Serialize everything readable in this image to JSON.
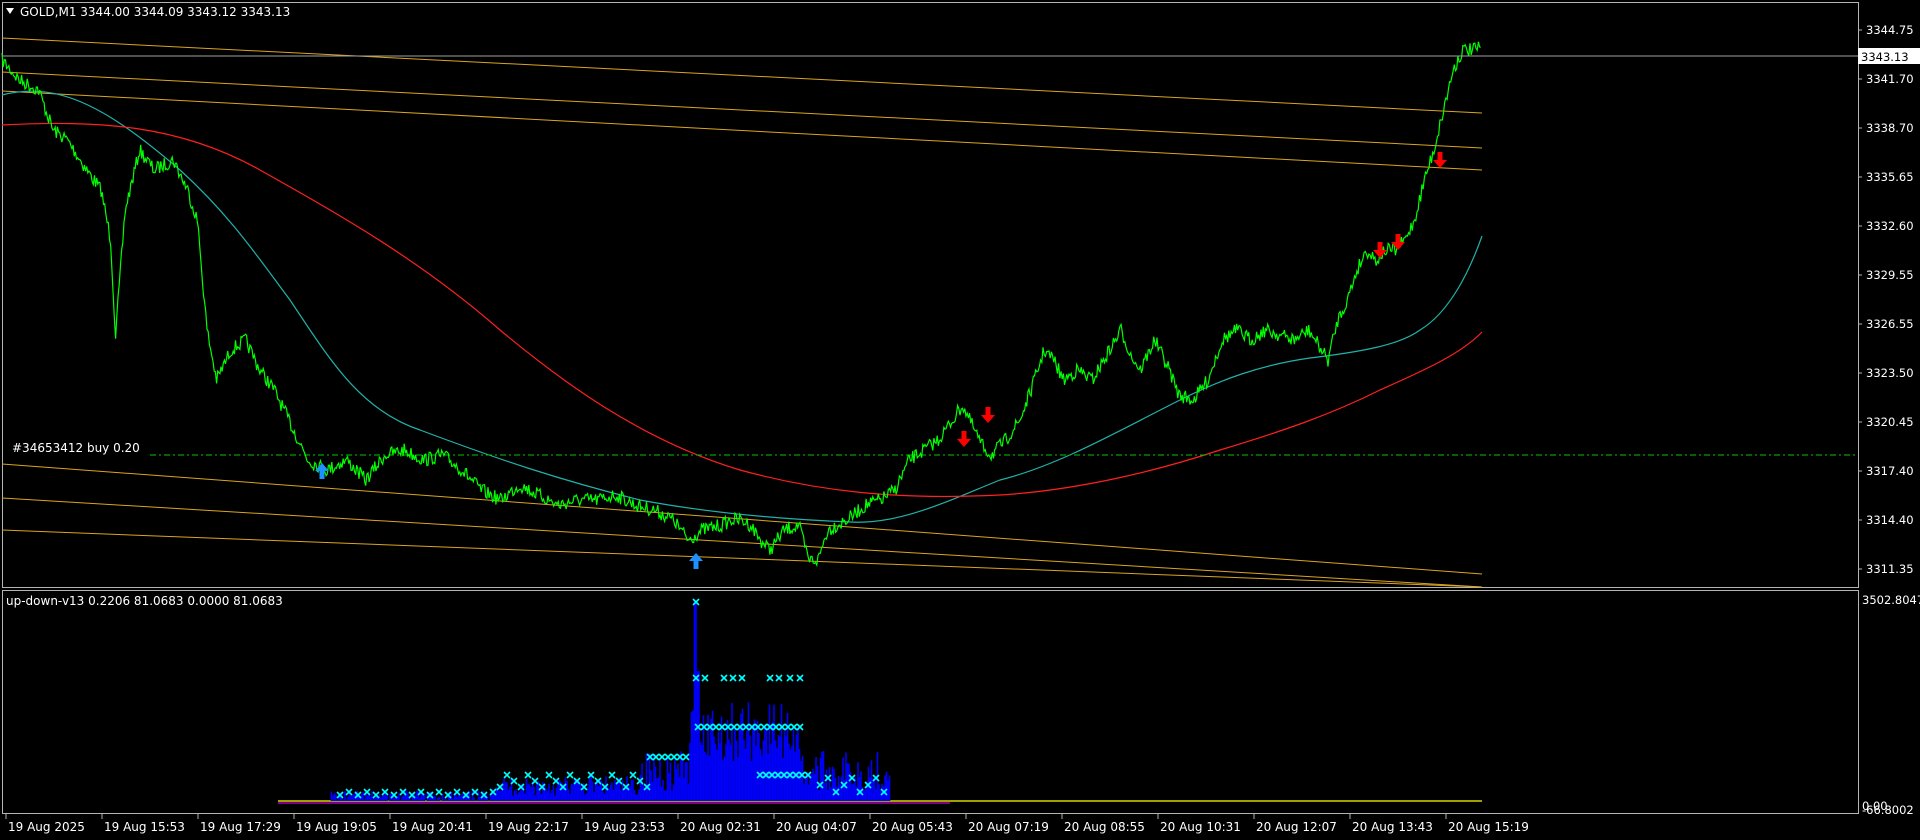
{
  "chart": {
    "header_text": "GOLD,M1  3344.00 3344.09 3343.12 3343.13",
    "current_price": "3343.13",
    "price_labels": [
      "3344.75",
      "3341.70",
      "3338.70",
      "3335.65",
      "3332.60",
      "3329.55",
      "3326.55",
      "3323.50",
      "3320.45",
      "3317.40",
      "3314.40",
      "3311.35"
    ],
    "order_label": "#34653412 buy 0.20",
    "colors": {
      "price_line": "#00ff00",
      "ma_fast": "#20b2aa",
      "ma_slow": "#ff2020",
      "channel": "#daa520",
      "order_line": "#00c800",
      "up_arrow": "#1e90ff",
      "down_arrow": "#ff0000"
    }
  },
  "indicator": {
    "header_text": "up-down-v13 0.2206 81.0683 0.0000 81.0683",
    "top_label": "3502.8047",
    "bottom_label_a": "0.00",
    "bottom_label_b": "-66.8002",
    "colors": {
      "histogram": "#0000ff",
      "markers": "#00ffff",
      "baseline": "#ffff00"
    }
  },
  "time_axis": [
    "19 Aug 2025",
    "19 Aug 15:53",
    "19 Aug 17:29",
    "19 Aug 19:05",
    "19 Aug 20:41",
    "19 Aug 22:17",
    "19 Aug 23:53",
    "20 Aug 02:31",
    "20 Aug 04:07",
    "20 Aug 05:43",
    "20 Aug 07:19",
    "20 Aug 08:55",
    "20 Aug 10:31",
    "20 Aug 12:07",
    "20 Aug 13:43",
    "20 Aug 15:19"
  ],
  "chart_data": {
    "type": "line",
    "title": "GOLD,M1",
    "series": [
      {
        "name": "GOLD,M1",
        "x": [
          "19 Aug 2025",
          "19 Aug 15:53",
          "19 Aug 17:29",
          "19 Aug 19:05",
          "19 Aug 20:41",
          "19 Aug 22:17",
          "19 Aug 23:53",
          "20 Aug 02:31",
          "20 Aug 04:07",
          "20 Aug 05:43",
          "20 Aug 07:19",
          "20 Aug 08:55",
          "20 Aug 10:31",
          "20 Aug 12:07",
          "20 Aug 13:43",
          "20 Aug 15:19"
        ],
        "values": [
          3342.5,
          3335.0,
          3323.5,
          3318.0,
          3318.5,
          3316.5,
          3316.0,
          3313.5,
          3315.0,
          3314.5,
          3320.0,
          3324.5,
          3324.0,
          3326.0,
          3331.0,
          3343.13
        ]
      }
    ],
    "ylim": [
      3311.35,
      3344.75
    ],
    "open": 3344.0,
    "high": 3344.09,
    "low": 3343.12,
    "close": 3343.13
  }
}
